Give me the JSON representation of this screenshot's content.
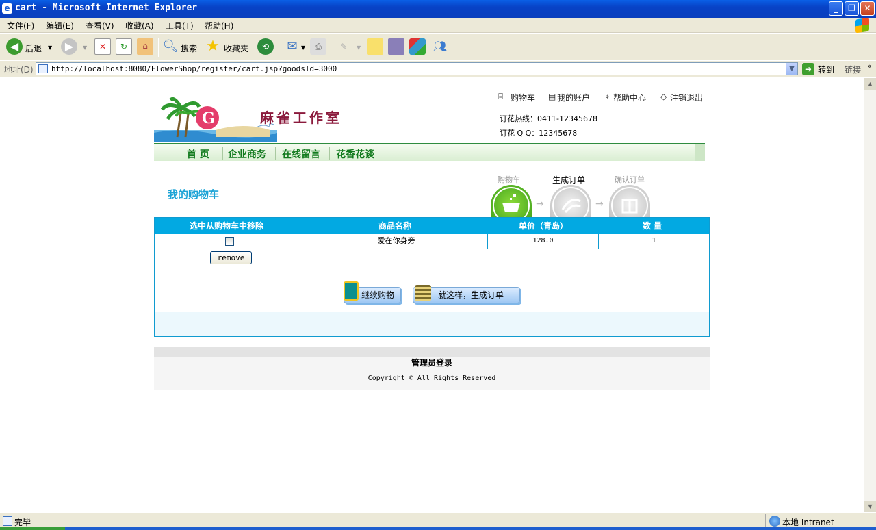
{
  "window": {
    "title": "cart - Microsoft Internet Explorer"
  },
  "menu": [
    "文件(F)",
    "编辑(E)",
    "查看(V)",
    "收藏(A)",
    "工具(T)",
    "帮助(H)"
  ],
  "toolbar": {
    "back": "后退",
    "search": "搜索",
    "favorites": "收藏夹"
  },
  "address": {
    "label": "地址(D)",
    "url": "http://localhost:8080/FlowerShop/register/cart.jsp?goodsId=3000",
    "go": "转到",
    "links": "链接"
  },
  "header": {
    "brand": "麻雀工作室",
    "toplinks": [
      "购物车",
      "我的账户",
      "帮助中心",
      "注销退出"
    ],
    "hotline": "订花热线：0411-12345678",
    "qq": "订花 Q Q：12345678"
  },
  "nav": [
    "首 页",
    "企业商务",
    "在线留言",
    "花香花谈"
  ],
  "steps": {
    "title": "我的购物车",
    "labels": [
      "购物车",
      "生成订单",
      "确认订单"
    ]
  },
  "cart": {
    "columns": [
      "选中从购物车中移除",
      "商品名称",
      "单价（青岛）",
      "数 量"
    ],
    "rows": [
      {
        "name": "爱在你身旁",
        "price": "128.0",
        "qty": "1"
      }
    ],
    "remove": "remove",
    "continue": "继续购物",
    "checkout": "就这样，生成订单"
  },
  "footer": {
    "admin": "管理员登录",
    "copyright": "Copyright © All Rights Reserved"
  },
  "status": {
    "text": "完毕",
    "zone": "本地 Intranet"
  },
  "colors": {
    "accent": "#02a9e2",
    "nav": "#117a1d",
    "titlebar": "#0a5fe6"
  }
}
